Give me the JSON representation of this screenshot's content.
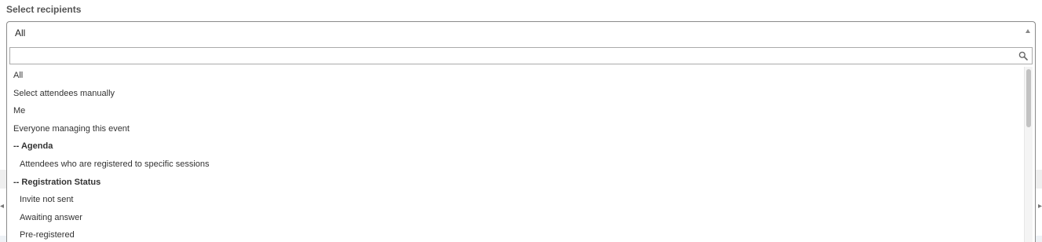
{
  "field": {
    "label": "Select recipients",
    "selected_value": "All"
  },
  "search": {
    "value": "",
    "placeholder": "",
    "icon": "search-icon"
  },
  "options": [
    {
      "label": "All",
      "kind": "option"
    },
    {
      "label": "Select attendees manually",
      "kind": "option"
    },
    {
      "label": "Me",
      "kind": "option"
    },
    {
      "label": "Everyone managing this event",
      "kind": "option"
    },
    {
      "label": "-- Agenda",
      "kind": "group"
    },
    {
      "label": "Attendees who are registered to specific sessions",
      "kind": "child"
    },
    {
      "label": "-- Registration Status",
      "kind": "group"
    },
    {
      "label": "Invite not sent",
      "kind": "child"
    },
    {
      "label": "Awaiting answer",
      "kind": "child"
    },
    {
      "label": "Pre-registered",
      "kind": "child"
    }
  ],
  "colors": {
    "border": "#8a8a8a",
    "text": "#333333",
    "label": "#555555",
    "scrollbar_thumb": "#c2c2c2"
  }
}
